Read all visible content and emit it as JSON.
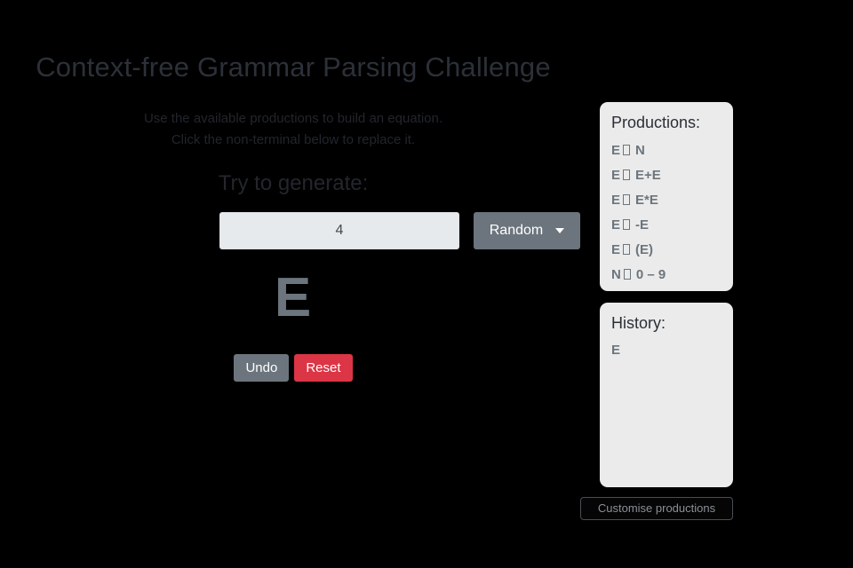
{
  "page": {
    "title": "Context-free Grammar Parsing Challenge",
    "instruction_line_1": "Use the available productions to build an equation.",
    "instruction_line_2": "Click the non-terminal below to replace it.",
    "background_color": "#000000"
  },
  "generator": {
    "heading": "Try to generate:",
    "target_value": "4",
    "target_placeholder": "",
    "random_label": "Random",
    "caret_icon": "chevron-down-icon"
  },
  "workspace": {
    "sentential_form": "E",
    "sentential_form_color": "#6c757d",
    "undo_label": "Undo",
    "reset_label": "Reset",
    "undo_color": "#6c757d",
    "reset_color": "#dc3545"
  },
  "productions_panel": {
    "heading": "Productions:",
    "arrow_glyph": "□",
    "items": [
      {
        "lhs": "E",
        "rhs": "N"
      },
      {
        "lhs": "E",
        "rhs": "E+E"
      },
      {
        "lhs": "E",
        "rhs": "E*E"
      },
      {
        "lhs": "E",
        "rhs": "-E"
      },
      {
        "lhs": "E",
        "rhs": "(E)"
      },
      {
        "lhs": "N",
        "rhs": "0 – 9"
      }
    ]
  },
  "history_panel": {
    "heading": "History:",
    "items": [
      "E"
    ]
  },
  "customise": {
    "label": "Customise productions"
  }
}
